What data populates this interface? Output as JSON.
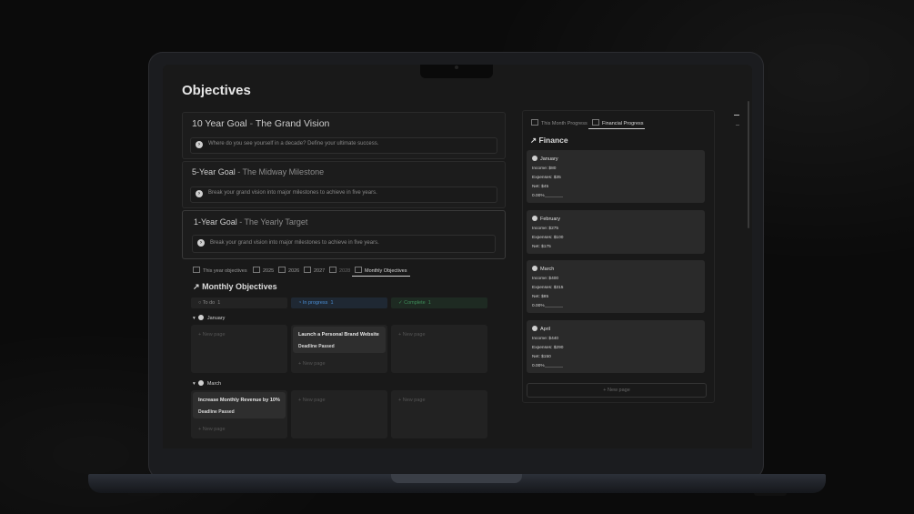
{
  "page": {
    "title": "Objectives"
  },
  "goals": [
    {
      "main": "10 Year Goal",
      "sep": " - ",
      "sub": "The Grand Vision",
      "prompt": "Where do you see yourself in a decade? Define your ultimate success."
    },
    {
      "main": "5-Year Goal",
      "sep": " - ",
      "sub": "The Midway Milestone",
      "prompt": "Break your grand vision into major milestones to achieve in five years."
    },
    {
      "main": "1-Year Goal",
      "sep": " - ",
      "sub": "The Yearly Target",
      "prompt": "Break your grand vision into major milestones to achieve in five years."
    }
  ],
  "tabs": [
    "This year objectives",
    "2025",
    "2026",
    "2027",
    "2028",
    "Monthly Objectives"
  ],
  "monthly": {
    "title": "Monthly Objectives",
    "arrow": "↗",
    "columns": [
      {
        "label": "To do",
        "count": "1",
        "color": "#8a8a8a"
      },
      {
        "label": "In progress",
        "count": "1",
        "color": "#4a8fd6"
      },
      {
        "label": "Complete",
        "count": "1",
        "color": "#3f8f5a"
      }
    ],
    "groups": [
      {
        "name": "January",
        "card_title": "Launch a Personal Brand Website",
        "card_status": "Deadline Passed"
      },
      {
        "name": "March",
        "card_title": "Increase Monthly Revenue by 10%",
        "card_status": "Deadline Passed"
      }
    ],
    "new_page": "New page"
  },
  "right": {
    "tabs": [
      "This Month Progress",
      "Financial Progress"
    ],
    "title": "Finance",
    "arrow": "↗",
    "months": [
      {
        "name": "January",
        "income": "Income: $80",
        "expenses": "Expenses: $35",
        "net": "Net: $45",
        "pct": "0.00%"
      },
      {
        "name": "February",
        "income": "Income: $275",
        "expenses": "Expenses: $100",
        "net": "Net: $175",
        "pct": ""
      },
      {
        "name": "March",
        "income": "Income: $400",
        "expenses": "Expenses: $315",
        "net": "Net: $85",
        "pct": "0.00%"
      },
      {
        "name": "April",
        "income": "Income: $440",
        "expenses": "Expenses: $290",
        "net": "Net: $150",
        "pct": "0.00%"
      }
    ],
    "new_page": "New page"
  }
}
